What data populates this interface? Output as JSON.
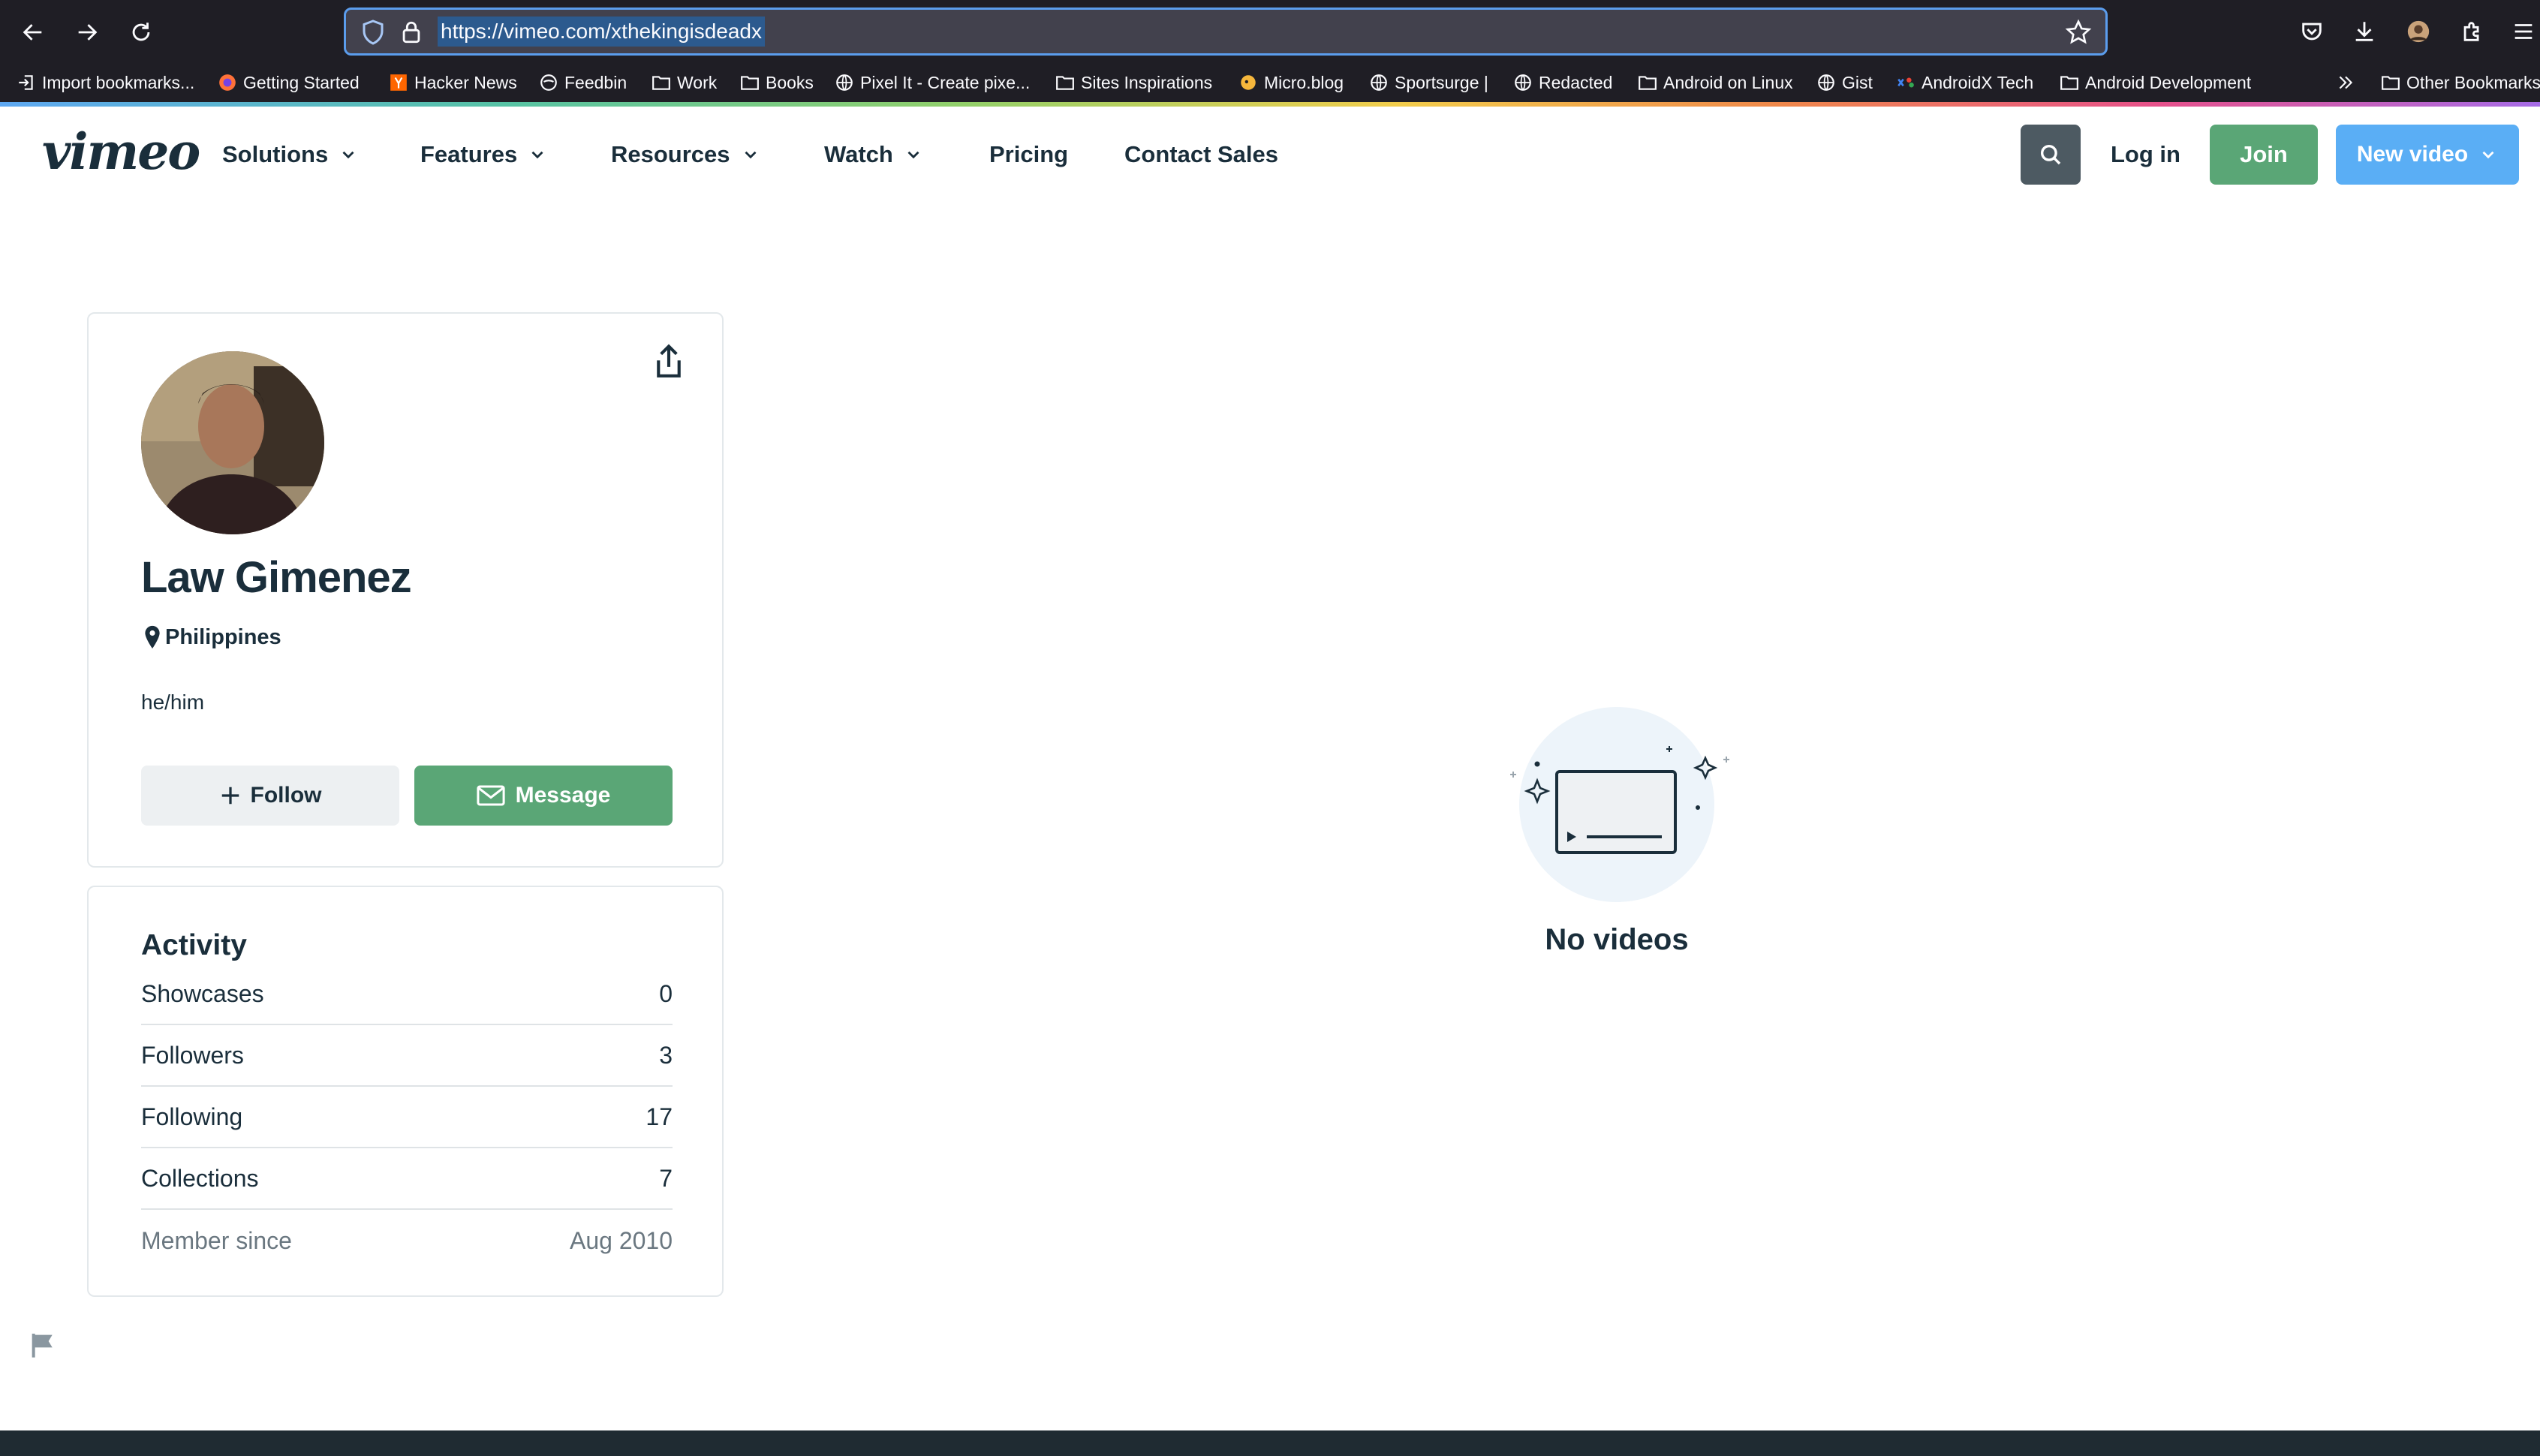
{
  "browser": {
    "url": "https://vimeo.com/xthekingisdeadx",
    "bookmarks": [
      {
        "label": "Import bookmarks...",
        "icon": "import-icon"
      },
      {
        "label": "Getting Started",
        "icon": "firefox-icon"
      },
      {
        "label": "Hacker News",
        "icon": "hacker-news-icon"
      },
      {
        "label": "Feedbin",
        "icon": "feedbin-icon"
      },
      {
        "label": "Work",
        "icon": "folder-icon"
      },
      {
        "label": "Books",
        "icon": "folder-icon"
      },
      {
        "label": "Pixel It - Create pixe...",
        "icon": "globe-icon"
      },
      {
        "label": "Sites Inspirations",
        "icon": "folder-icon"
      },
      {
        "label": "Micro.blog",
        "icon": "microblog-icon"
      },
      {
        "label": "Sportsurge |",
        "icon": "globe-icon"
      },
      {
        "label": "Redacted",
        "icon": "globe-icon"
      },
      {
        "label": "Android on Linux",
        "icon": "folder-icon"
      },
      {
        "label": "Gist",
        "icon": "globe-icon"
      },
      {
        "label": "AndroidX Tech",
        "icon": "androidx-icon"
      },
      {
        "label": "Android Development",
        "icon": "folder-icon"
      }
    ],
    "other_bookmarks": "Other Bookmarks"
  },
  "header": {
    "logo": "vimeo",
    "nav": [
      {
        "label": "Solutions",
        "dropdown": true
      },
      {
        "label": "Features",
        "dropdown": true
      },
      {
        "label": "Resources",
        "dropdown": true
      },
      {
        "label": "Watch",
        "dropdown": true
      },
      {
        "label": "Pricing",
        "dropdown": false
      },
      {
        "label": "Contact Sales",
        "dropdown": false
      }
    ],
    "login": "Log in",
    "join": "Join",
    "new_video": "New video"
  },
  "profile": {
    "name": "Law Gimenez",
    "location": "Philippines",
    "pronouns": "he/him",
    "follow_label": "Follow",
    "message_label": "Message"
  },
  "activity": {
    "title": "Activity",
    "rows": [
      {
        "label": "Showcases",
        "value": "0"
      },
      {
        "label": "Followers",
        "value": "3"
      },
      {
        "label": "Following",
        "value": "17"
      },
      {
        "label": "Collections",
        "value": "7"
      },
      {
        "label": "Member since",
        "value": "Aug 2010"
      }
    ]
  },
  "videos": {
    "empty_text": "No videos"
  },
  "colors": {
    "accent_green": "#5aa676",
    "accent_blue": "#5aaef5",
    "text_dark": "#1a2e3b"
  }
}
